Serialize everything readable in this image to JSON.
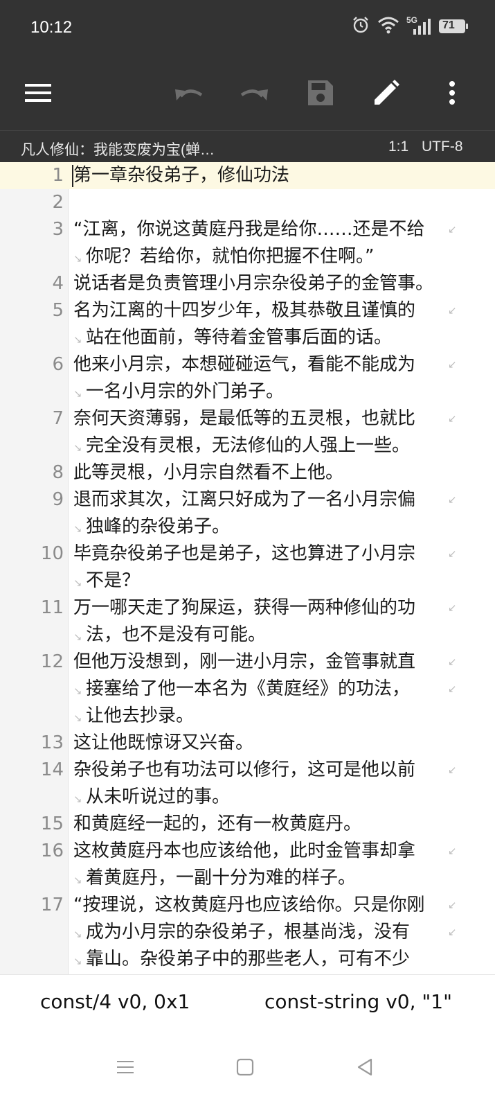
{
  "status_bar": {
    "time": "10:12",
    "network": "5G",
    "battery": "71"
  },
  "toolbar": {
    "menu_icon": "hamburger-menu-icon",
    "undo_icon": "undo-icon",
    "redo_icon": "redo-icon",
    "save_icon": "save-icon",
    "edit_icon": "pencil-icon",
    "more_icon": "more-vert-icon"
  },
  "info_bar": {
    "file_name": "凡人修仙：我能变废为宝(蝉…",
    "cursor_position": "1:1",
    "encoding": "UTF-8"
  },
  "editor": {
    "lines": [
      {
        "number": "1",
        "segments": [
          "第一章杂役弟子，修仙功法"
        ]
      },
      {
        "number": "2",
        "segments": [
          ""
        ]
      },
      {
        "number": "3",
        "segments": [
          "“江离，你说这黄庭丹我是给你……还是不给",
          "你呢？若给你，就怕你把握不住啊。”"
        ]
      },
      {
        "number": "4",
        "segments": [
          "说话者是负责管理小月宗杂役弟子的金管事。"
        ]
      },
      {
        "number": "5",
        "segments": [
          "名为江离的十四岁少年，极其恭敬且谨慎的",
          "站在他面前，等待着金管事后面的话。"
        ]
      },
      {
        "number": "6",
        "segments": [
          "他来小月宗，本想碰碰运气，看能不能成为",
          "一名小月宗的外门弟子。"
        ]
      },
      {
        "number": "7",
        "segments": [
          "奈何天资薄弱，是最低等的五灵根，也就比",
          "完全没有灵根，无法修仙的人强上一些。"
        ]
      },
      {
        "number": "8",
        "segments": [
          "此等灵根，小月宗自然看不上他。"
        ]
      },
      {
        "number": "9",
        "segments": [
          "退而求其次，江离只好成为了一名小月宗偏",
          "独峰的杂役弟子。"
        ]
      },
      {
        "number": "10",
        "segments": [
          "毕竟杂役弟子也是弟子，这也算进了小月宗",
          "不是？"
        ]
      },
      {
        "number": "11",
        "segments": [
          "万一哪天走了狗屎运，获得一两种修仙的功",
          "法，也不是没有可能。"
        ]
      },
      {
        "number": "12",
        "segments": [
          "但他万没想到，刚一进小月宗，金管事就直",
          "接塞给了他一本名为《黄庭经》的功法，",
          "让他去抄录。"
        ]
      },
      {
        "number": "13",
        "segments": [
          "这让他既惊讶又兴奋。"
        ]
      },
      {
        "number": "14",
        "segments": [
          "杂役弟子也有功法可以修行，这可是他以前",
          "从未听说过的事。"
        ]
      },
      {
        "number": "15",
        "segments": [
          "和黄庭经一起的，还有一枚黄庭丹。"
        ]
      },
      {
        "number": "16",
        "segments": [
          "这枚黄庭丹本也应该给他，此时金管事却拿",
          "着黄庭丹，一副十分为难的样子。"
        ]
      },
      {
        "number": "17",
        "segments": [
          "“按理说，这枚黄庭丹也应该给你。只是你刚",
          "成为小月宗的杂役弟子，根基尚浅，没有",
          "靠山。杂役弟子中的那些老人，可有不少"
        ]
      }
    ]
  },
  "smali_bar": {
    "left_snippet": "const/4 v0, 0x1",
    "right_snippet": "const-string v0, \"1\""
  },
  "nav_bar": {
    "recents_icon": "recents-icon",
    "home_icon": "home-icon",
    "back_icon": "back-icon"
  },
  "colors": {
    "toolbar_bg": "#333333",
    "active_line_bg": "#fdf9e3",
    "gutter_bg": "#f4f4f4"
  }
}
